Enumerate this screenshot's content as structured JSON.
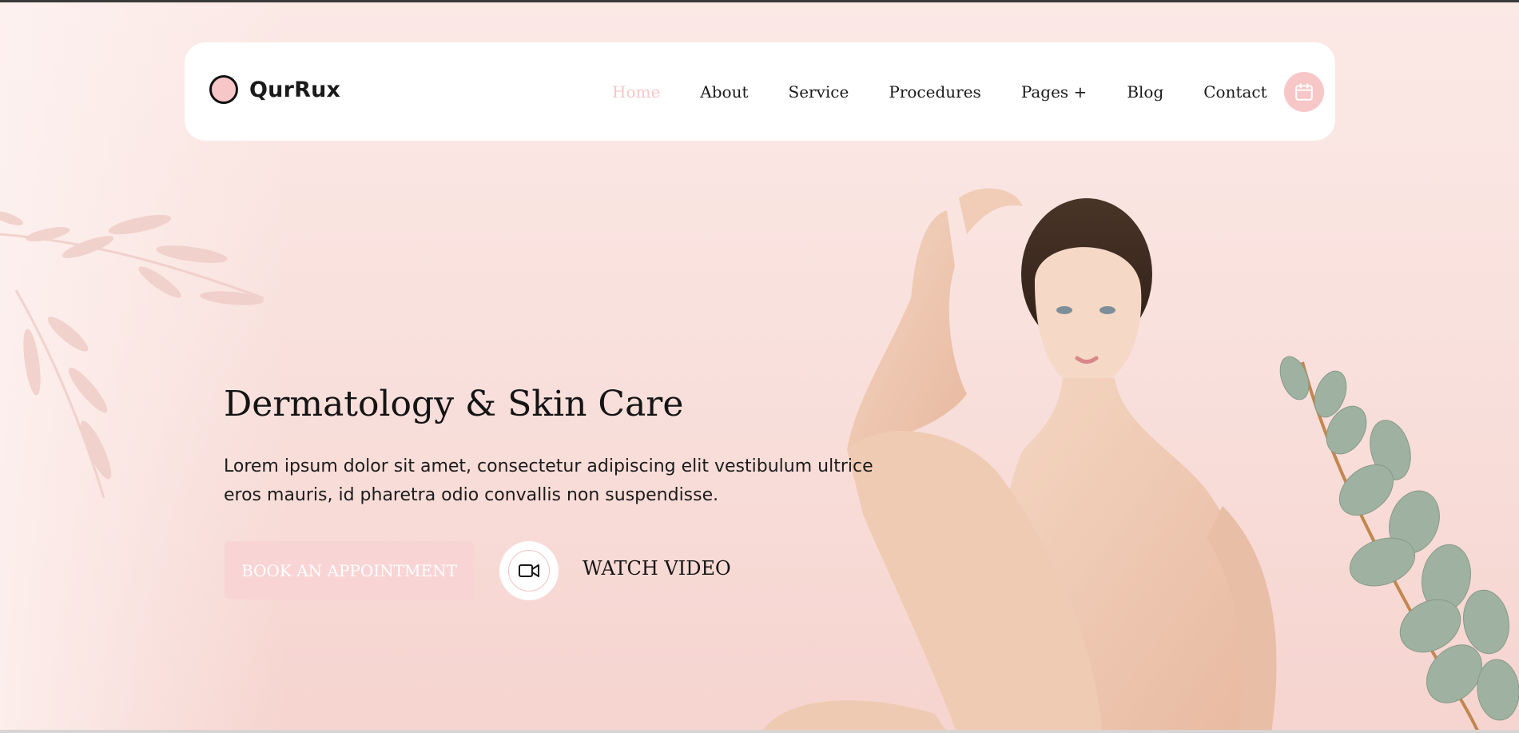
{
  "brand": {
    "name": "QurRux"
  },
  "nav": {
    "items": [
      {
        "label": "Home",
        "active": true
      },
      {
        "label": "About"
      },
      {
        "label": "Service"
      },
      {
        "label": "Procedures"
      },
      {
        "label": "Pages +"
      },
      {
        "label": "Blog"
      },
      {
        "label": "Contact"
      }
    ],
    "calendar_icon": "calendar-icon"
  },
  "hero": {
    "title": "Dermatology & Skin Care",
    "description": "Lorem ipsum dolor sit amet, consectetur adipiscing elit vestibulum ultrice eros mauris, id pharetra odio convallis non suspendisse.",
    "primary_button": "BOOK AN APPOINTMENT",
    "video_icon": "video-camera-icon",
    "video_label": "WATCH VIDEO"
  },
  "colors": {
    "accent": "#f7c6c7",
    "button_bg": "#f9d4d4",
    "background": "#f8dedb",
    "text": "#141414"
  }
}
